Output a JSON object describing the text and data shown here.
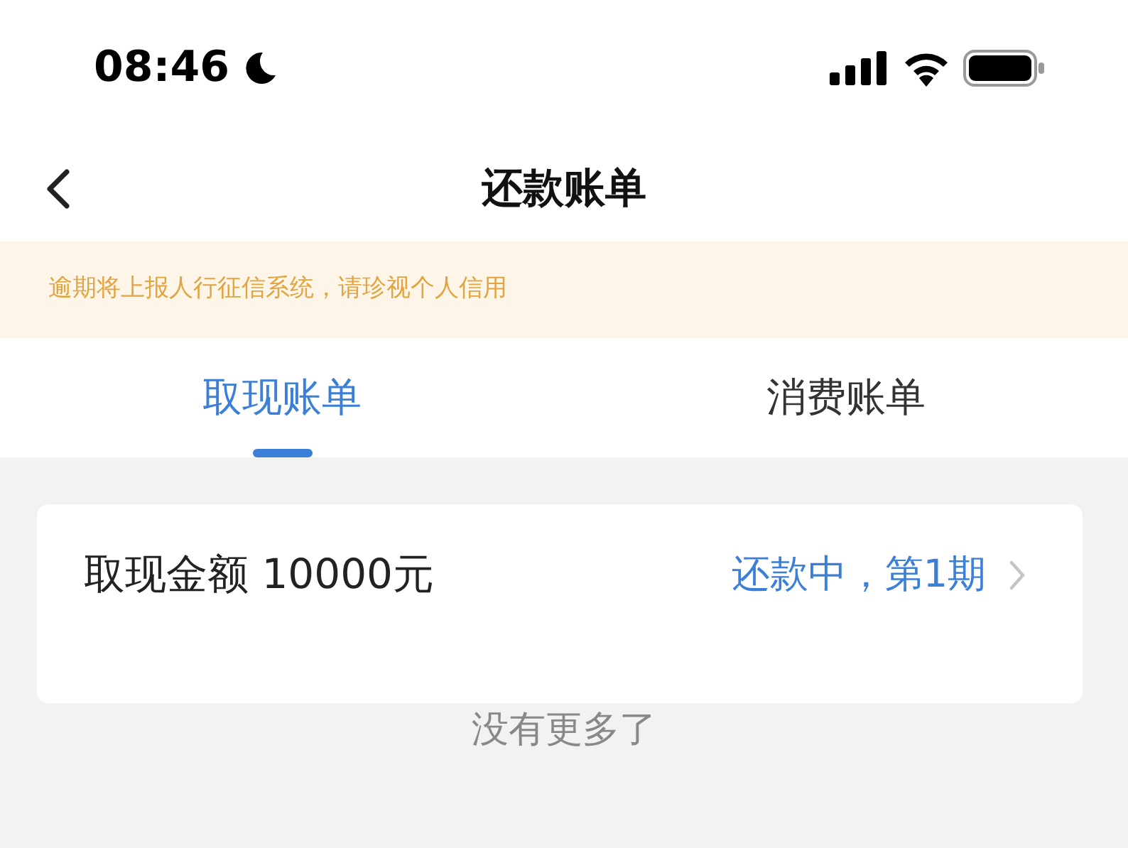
{
  "status_bar": {
    "time": "08:46"
  },
  "nav": {
    "title": "还款账单"
  },
  "notice": {
    "text": "逾期将上报人行征信系统，请珍视个人信用"
  },
  "tabs": [
    {
      "label": "取现账单",
      "selected": true
    },
    {
      "label": "消费账单",
      "selected": false
    }
  ],
  "bills": [
    {
      "amount": "取现金额 10000元",
      "status": "还款中，第1期"
    }
  ],
  "footer": {
    "text": "没有更多了"
  }
}
